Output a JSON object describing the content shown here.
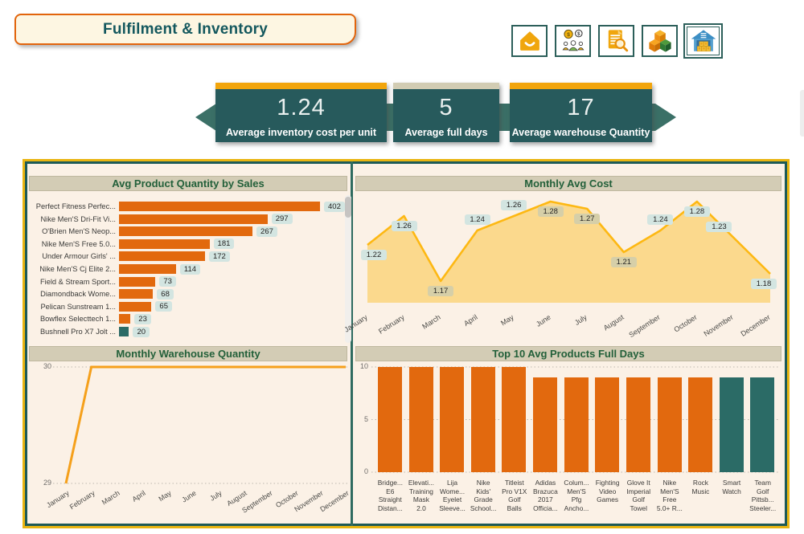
{
  "title_card": {
    "label": "Fulfilment & Inventory"
  },
  "nav": {
    "items": [
      {
        "name": "home",
        "icon": "home-icon",
        "selected": false
      },
      {
        "name": "customers",
        "icon": "customers-coins-icon",
        "selected": false
      },
      {
        "name": "report-search",
        "icon": "report-search-icon",
        "selected": false
      },
      {
        "name": "products",
        "icon": "products-boxes-icon",
        "selected": false
      },
      {
        "name": "warehouse",
        "icon": "warehouse-icon",
        "selected": true
      }
    ]
  },
  "kpis": [
    {
      "value": "1.24",
      "label": "Average  inventory  cost  per  unit",
      "accent": "#F2A50C"
    },
    {
      "value": "5",
      "label": "Average full days",
      "accent": "#D2CCB3"
    },
    {
      "value": "17",
      "label": "Average warehouse Quantity",
      "accent": "#F2A50C"
    }
  ],
  "colors": {
    "bar_orange": "#E2690E",
    "bar_teal": "#2B6B66",
    "area_fill": "#FBD98D",
    "area_line": "#FDB813",
    "line_orange": "#F5A01B",
    "grid_dot": "#BDB8AE"
  },
  "chart_data": [
    {
      "id": "avg_product_quantity_by_sales",
      "type": "bar",
      "orientation": "horizontal",
      "title": "Avg Product Quantity by Sales",
      "categories": [
        "Perfect Fitness Perfec...",
        "Nike Men'S Dri-Fit Vi...",
        "O'Brien Men'S Neop...",
        "Nike Men'S Free 5.0...",
        "Under Armour Girls' ...",
        "Nike Men'S Cj Elite 2...",
        "Field & Stream Sport...",
        "Diamondback Wome...",
        "Pelican Sunstream 1...",
        "Bowflex Selecttech 1...",
        "Bushnell Pro X7 Jolt ..."
      ],
      "values": [
        402,
        297,
        267,
        181,
        172,
        114,
        73,
        68,
        65,
        23,
        20
      ],
      "bar_colors": [
        "orange",
        "orange",
        "orange",
        "orange",
        "orange",
        "orange",
        "orange",
        "orange",
        "orange",
        "orange",
        "teal"
      ],
      "xlim": [
        0,
        430
      ],
      "has_scrollbar": true
    },
    {
      "id": "monthly_avg_cost",
      "type": "area",
      "title": "Monthly Avg Cost",
      "x": [
        "January",
        "February",
        "March",
        "April",
        "May",
        "June",
        "July",
        "August",
        "September",
        "October",
        "November",
        "December"
      ],
      "values": [
        1.22,
        1.26,
        1.17,
        1.24,
        1.26,
        1.28,
        1.27,
        1.21,
        1.24,
        1.28,
        1.23,
        1.18
      ],
      "ylim": [
        1.14,
        1.3
      ],
      "grid": false,
      "label_side": [
        "below",
        "below",
        "below",
        "above",
        "above",
        "below",
        "below",
        "below",
        "above",
        "below",
        "above",
        "below"
      ],
      "label_dx": [
        8,
        0,
        0,
        0,
        0,
        0,
        0,
        0,
        0,
        0,
        -18,
        -8
      ],
      "label_tone": [
        "teal",
        "teal",
        "olive",
        "teal",
        "teal",
        "olive",
        "olive",
        "olive",
        "teal",
        "teal",
        "teal",
        "teal"
      ]
    },
    {
      "id": "monthly_warehouse_quantity",
      "type": "line",
      "title": "Monthly Warehouse Quantity",
      "x": [
        "January",
        "February",
        "March",
        "April",
        "May",
        "June",
        "July",
        "August",
        "September",
        "October",
        "November",
        "December"
      ],
      "values": [
        29,
        30,
        30,
        30,
        30,
        30,
        30,
        30,
        30,
        30,
        30,
        30
      ],
      "ylim": [
        29,
        30
      ],
      "yticks": [
        29,
        30
      ],
      "grid": "dotted"
    },
    {
      "id": "top10_avg_products_full_days",
      "type": "bar",
      "orientation": "vertical",
      "title": "Top 10 Avg Products Full Days",
      "categories": [
        [
          "Bridge...",
          "E6",
          "Straight",
          "Distan..."
        ],
        [
          "Elevati...",
          "Training",
          "Mask",
          "2.0"
        ],
        [
          "Lija",
          "Wome...",
          "Eyelet",
          "Sleeve..."
        ],
        [
          "Nike",
          "Kids'",
          "Grade",
          "School..."
        ],
        [
          "Titleist",
          "Pro V1X",
          "Golf",
          "Balls"
        ],
        [
          "Adidas",
          "Brazuca",
          "2017",
          "Officia..."
        ],
        [
          "Colum...",
          "Men'S",
          "Pfg",
          "Ancho..."
        ],
        [
          "Fighting",
          "Video",
          "Games"
        ],
        [
          "Glove It",
          "Imperial",
          "Golf",
          "Towel"
        ],
        [
          "Nike",
          "Men'S",
          "Free",
          "5.0+ R..."
        ],
        [
          "Rock",
          "Music"
        ],
        [
          "Smart",
          "Watch"
        ],
        [
          "Team",
          "Golf",
          "Pittsb...",
          "Steeler..."
        ]
      ],
      "values": [
        10,
        10,
        10,
        10,
        10,
        9,
        9,
        9,
        9,
        9,
        9,
        9,
        9
      ],
      "bar_colors": [
        "orange",
        "orange",
        "orange",
        "orange",
        "orange",
        "orange",
        "orange",
        "orange",
        "orange",
        "orange",
        "orange",
        "teal",
        "teal"
      ],
      "ylim": [
        0,
        10
      ],
      "yticks": [
        0,
        5,
        10
      ],
      "grid": "dotted"
    }
  ]
}
